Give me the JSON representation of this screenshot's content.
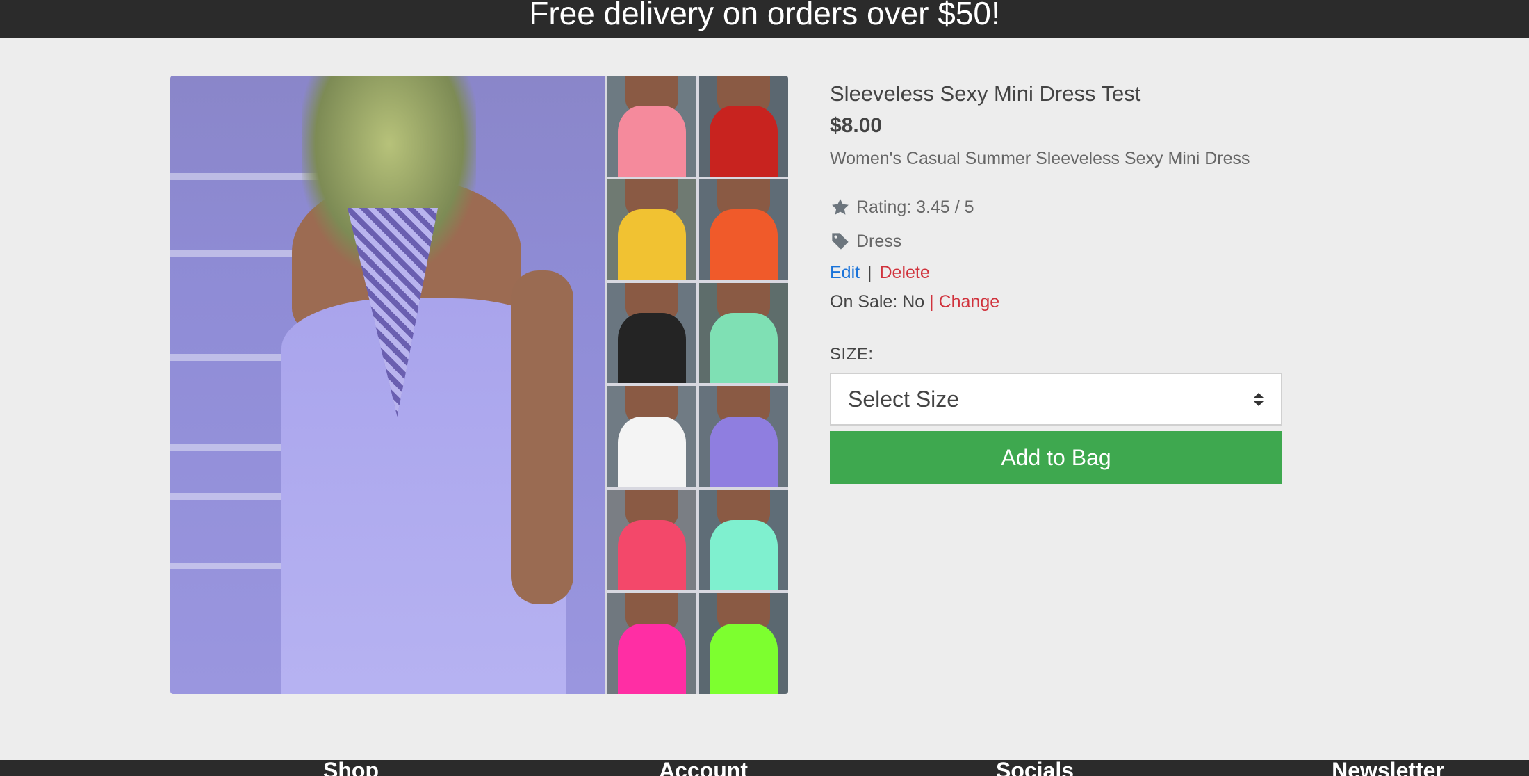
{
  "banner": {
    "text": "Free delivery on orders over $50!"
  },
  "product": {
    "title": "Sleeveless Sexy Mini Dress Test",
    "price": "$8.00",
    "description": "Women's Casual Summer Sleeveless Sexy Mini Dress",
    "rating_text": "Rating: 3.45 / 5",
    "rating_icon": "star-icon",
    "category": "Dress",
    "category_icon": "tag-icon",
    "image_colors": [
      "#f58a9c",
      "#c8231f",
      "#f1c232",
      "#f05a2a",
      "#242424",
      "#7fe0b4",
      "#f4f4f4",
      "#8f7ee0",
      "#f3486a",
      "#7ff0cf",
      "#ff2ea4",
      "#7dff2f"
    ]
  },
  "admin": {
    "edit_label": "Edit",
    "separator": "|",
    "delete_label": "Delete",
    "on_sale_text": "On Sale: No",
    "change_label": "| Change"
  },
  "size": {
    "label": "SIZE:",
    "selected": "Select Size"
  },
  "cart": {
    "add_label": "Add to Bag"
  },
  "footer": {
    "columns": [
      "Shop",
      "Account",
      "Socials",
      "Newsletter"
    ]
  },
  "colors": {
    "accent_green": "#3ea84f",
    "link_blue": "#1a73d9",
    "danger_red": "#d0323c",
    "dark_bar": "#2b2b2b"
  }
}
